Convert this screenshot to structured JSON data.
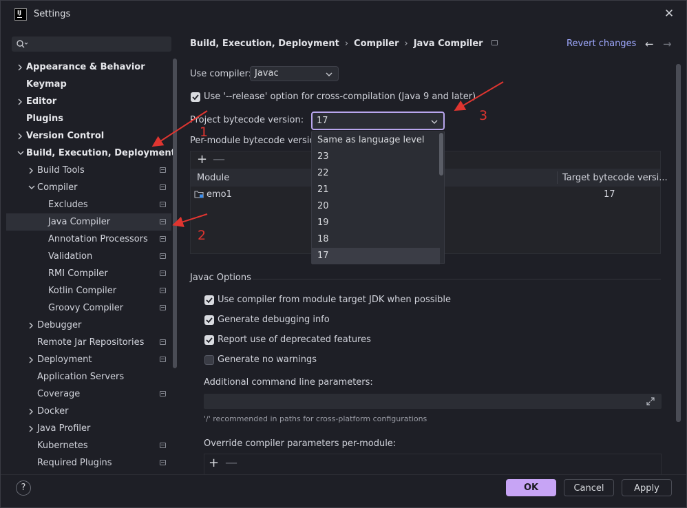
{
  "window": {
    "title": "Settings",
    "app_icon_text": "IJ"
  },
  "search": {
    "placeholder": ""
  },
  "sidebar": {
    "items": [
      {
        "label": "Appearance & Behavior",
        "bold": true,
        "chevron": "right",
        "indent": 0,
        "doc": false
      },
      {
        "label": "Keymap",
        "bold": true,
        "chevron": "",
        "indent": 0,
        "doc": false
      },
      {
        "label": "Editor",
        "bold": true,
        "chevron": "right",
        "indent": 0,
        "doc": false
      },
      {
        "label": "Plugins",
        "bold": true,
        "chevron": "",
        "indent": 0,
        "doc": false
      },
      {
        "label": "Version Control",
        "bold": true,
        "chevron": "right",
        "indent": 0,
        "doc": false
      },
      {
        "label": "Build, Execution, Deployment",
        "bold": true,
        "chevron": "down",
        "indent": 0,
        "doc": false
      },
      {
        "label": "Build Tools",
        "bold": false,
        "chevron": "right",
        "indent": 1,
        "doc": true
      },
      {
        "label": "Compiler",
        "bold": false,
        "chevron": "down",
        "indent": 1,
        "doc": true
      },
      {
        "label": "Excludes",
        "bold": false,
        "chevron": "",
        "indent": 2,
        "doc": true
      },
      {
        "label": "Java Compiler",
        "bold": false,
        "chevron": "",
        "indent": 2,
        "doc": true,
        "selected": true
      },
      {
        "label": "Annotation Processors",
        "bold": false,
        "chevron": "",
        "indent": 2,
        "doc": true
      },
      {
        "label": "Validation",
        "bold": false,
        "chevron": "",
        "indent": 2,
        "doc": true
      },
      {
        "label": "RMI Compiler",
        "bold": false,
        "chevron": "",
        "indent": 2,
        "doc": true
      },
      {
        "label": "Kotlin Compiler",
        "bold": false,
        "chevron": "",
        "indent": 2,
        "doc": true
      },
      {
        "label": "Groovy Compiler",
        "bold": false,
        "chevron": "",
        "indent": 2,
        "doc": true
      },
      {
        "label": "Debugger",
        "bold": false,
        "chevron": "right",
        "indent": 1,
        "doc": false
      },
      {
        "label": "Remote Jar Repositories",
        "bold": false,
        "chevron": "",
        "indent": 1,
        "doc": true
      },
      {
        "label": "Deployment",
        "bold": false,
        "chevron": "right",
        "indent": 1,
        "doc": true
      },
      {
        "label": "Application Servers",
        "bold": false,
        "chevron": "",
        "indent": 1,
        "doc": false
      },
      {
        "label": "Coverage",
        "bold": false,
        "chevron": "",
        "indent": 1,
        "doc": true
      },
      {
        "label": "Docker",
        "bold": false,
        "chevron": "right",
        "indent": 1,
        "doc": false
      },
      {
        "label": "Java Profiler",
        "bold": false,
        "chevron": "right",
        "indent": 1,
        "doc": false
      },
      {
        "label": "Kubernetes",
        "bold": false,
        "chevron": "",
        "indent": 1,
        "doc": true
      },
      {
        "label": "Required Plugins",
        "bold": false,
        "chevron": "",
        "indent": 1,
        "doc": true
      }
    ]
  },
  "breadcrumb": {
    "parts": [
      "Build, Execution, Deployment",
      "Compiler",
      "Java Compiler"
    ],
    "separator": "›"
  },
  "header": {
    "revert": "Revert changes",
    "back": "←",
    "forward": "→"
  },
  "compiler": {
    "use_compiler_label": "Use compiler:",
    "use_compiler_value": "Javac",
    "release_option_label": "Use '--release' option for cross-compilation (Java 9 and later)",
    "release_option_checked": true,
    "bytecode_label": "Project bytecode version:",
    "bytecode_value": "17",
    "per_module_label": "Per-module bytecode version:"
  },
  "dropdown": {
    "options": [
      "Same as language level",
      "23",
      "22",
      "21",
      "20",
      "19",
      "18",
      "17"
    ],
    "selected": "17"
  },
  "module_table": {
    "plus": "+",
    "minus": "—",
    "columns": [
      "Module",
      "Target bytecode versi..."
    ],
    "rows": [
      {
        "module": "emo1",
        "target": "17"
      }
    ]
  },
  "javac_options": {
    "title": "Javac Options",
    "checkboxes": [
      {
        "label": "Use compiler from module target JDK when possible",
        "checked": true
      },
      {
        "label": "Generate debugging info",
        "checked": true
      },
      {
        "label": "Report use of deprecated features",
        "checked": true
      },
      {
        "label": "Generate no warnings",
        "checked": false
      }
    ],
    "additional_label": "Additional command line parameters:",
    "additional_value": "",
    "hint": "'/' recommended in paths for cross-platform configurations",
    "override_label": "Override compiler parameters per-module:",
    "override_plus": "+",
    "override_minus": "—"
  },
  "footer": {
    "help": "?",
    "ok": "OK",
    "cancel": "Cancel",
    "apply": "Apply"
  },
  "annotations": {
    "a1": "1",
    "a2": "2",
    "a3": "3",
    "color": "#e03530"
  }
}
